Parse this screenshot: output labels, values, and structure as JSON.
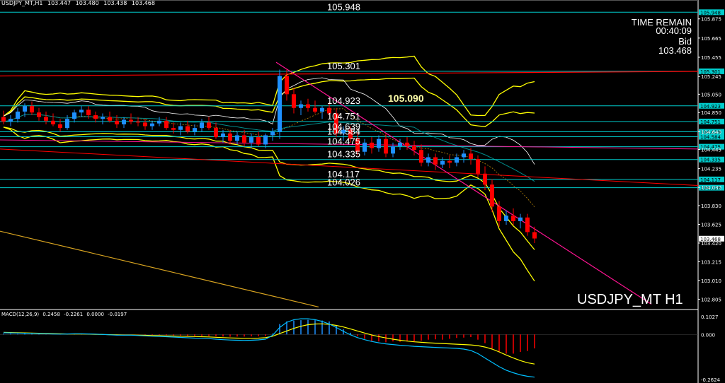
{
  "header": {
    "symbol_tf": "USDJPY_MT,H1",
    "open": "103.447",
    "high": "103.480",
    "low": "103.438",
    "close": "103.468"
  },
  "info_panel": {
    "time_remain_label": "TIME REMAIN",
    "time_remain_value": "00:40:09",
    "bid_label": "Bid",
    "bid_value": "103.468"
  },
  "watermark": "USDJPY_MT H1",
  "macd_header": {
    "name": "MACD(12,26,9)",
    "v1": "0.2458",
    "v2": "-0.2261",
    "v3": "0.0000",
    "v4": "-0.0197"
  },
  "colors": {
    "background": "#000000",
    "bull_candle": "#1e90ff",
    "bear_candle": "#ff0000",
    "bollinger": "#ffff00",
    "level_line": "#00cccc",
    "trend_line": "#ff1493",
    "red_line": "#ff0000",
    "macd_signal": "#ffff00",
    "macd_line": "#00bfff"
  },
  "chart_data": {
    "type": "candlestick",
    "symbol": "USDJPY_MT",
    "timeframe": "H1",
    "ylim": [
      102.7,
      106.02
    ],
    "price_axis_ticks": [
      "105.875",
      "105.665",
      "105.455",
      "105.245",
      "105.050",
      "104.850",
      "104.640",
      "104.445",
      "104.235",
      "104.030",
      "103.830",
      "103.625",
      "103.420",
      "103.215",
      "103.010",
      "102.805"
    ],
    "level_lines": [
      {
        "price": 105.948,
        "label": "105.948"
      },
      {
        "price": 105.301,
        "label": "105.301"
      },
      {
        "price": 104.923,
        "label": "104.923"
      },
      {
        "price": 104.751,
        "label": "104.751"
      },
      {
        "price": 104.639,
        "label": "104.639"
      },
      {
        "price": 104.584,
        "label": "104.584"
      },
      {
        "price": 104.475,
        "label": "104.475"
      },
      {
        "price": 104.335,
        "label": "104.335"
      },
      {
        "price": 104.117,
        "label": "104.117"
      },
      {
        "price": 104.026,
        "label": "104.026"
      }
    ],
    "highlight_label": "105.090",
    "current_price": "103.468",
    "candles": [
      [
        104.8,
        104.87,
        104.72,
        104.75
      ],
      [
        104.75,
        104.82,
        104.7,
        104.78
      ],
      [
        104.78,
        104.9,
        104.74,
        104.86
      ],
      [
        104.86,
        104.95,
        104.8,
        104.92
      ],
      [
        104.92,
        104.97,
        104.82,
        104.85
      ],
      [
        104.85,
        104.9,
        104.76,
        104.8
      ],
      [
        104.8,
        104.86,
        104.72,
        104.76
      ],
      [
        104.76,
        104.84,
        104.7,
        104.72
      ],
      [
        104.72,
        104.78,
        104.64,
        104.68
      ],
      [
        104.68,
        104.82,
        104.66,
        104.78
      ],
      [
        104.78,
        104.88,
        104.74,
        104.85
      ],
      [
        104.85,
        104.92,
        104.8,
        104.88
      ],
      [
        104.88,
        104.92,
        104.78,
        104.82
      ],
      [
        104.82,
        104.86,
        104.74,
        104.78
      ],
      [
        104.78,
        104.84,
        104.72,
        104.8
      ],
      [
        104.8,
        104.86,
        104.74,
        104.76
      ],
      [
        104.76,
        104.82,
        104.68,
        104.72
      ],
      [
        104.72,
        104.8,
        104.68,
        104.77
      ],
      [
        104.77,
        104.84,
        104.72,
        104.75
      ],
      [
        104.75,
        104.8,
        104.7,
        104.74
      ],
      [
        104.74,
        104.78,
        104.66,
        104.7
      ],
      [
        104.7,
        104.76,
        104.66,
        104.73
      ],
      [
        104.73,
        104.8,
        104.7,
        104.76
      ],
      [
        104.76,
        104.8,
        104.66,
        104.68
      ],
      [
        104.68,
        104.74,
        104.62,
        104.66
      ],
      [
        104.66,
        104.74,
        104.6,
        104.7
      ],
      [
        104.7,
        104.76,
        104.62,
        104.64
      ],
      [
        104.64,
        104.72,
        104.6,
        104.68
      ],
      [
        104.68,
        104.78,
        104.64,
        104.74
      ],
      [
        104.74,
        104.8,
        104.66,
        104.68
      ],
      [
        104.68,
        104.74,
        104.56,
        104.58
      ],
      [
        104.58,
        104.66,
        104.52,
        104.62
      ],
      [
        104.62,
        104.66,
        104.5,
        104.54
      ],
      [
        104.54,
        104.64,
        104.5,
        104.6
      ],
      [
        104.6,
        104.66,
        104.48,
        104.52
      ],
      [
        104.52,
        104.62,
        104.46,
        104.58
      ],
      [
        104.58,
        104.64,
        104.48,
        104.5
      ],
      [
        104.5,
        104.62,
        104.46,
        104.6
      ],
      [
        104.6,
        104.68,
        104.54,
        104.64
      ],
      [
        104.64,
        105.32,
        104.56,
        105.25
      ],
      [
        105.25,
        105.32,
        104.98,
        105.05
      ],
      [
        105.05,
        105.12,
        104.84,
        104.9
      ],
      [
        104.9,
        104.98,
        104.82,
        104.94
      ],
      [
        104.94,
        105.0,
        104.86,
        104.9
      ],
      [
        104.9,
        104.98,
        104.84,
        104.86
      ],
      [
        104.86,
        104.92,
        104.78,
        104.9
      ],
      [
        104.9,
        104.96,
        104.82,
        104.84
      ],
      [
        104.84,
        104.9,
        104.58,
        104.62
      ],
      [
        104.62,
        104.7,
        104.54,
        104.66
      ],
      [
        104.66,
        104.7,
        104.52,
        104.56
      ],
      [
        104.56,
        104.64,
        104.38,
        104.42
      ],
      [
        104.42,
        104.56,
        104.38,
        104.52
      ],
      [
        104.52,
        104.58,
        104.4,
        104.46
      ],
      [
        104.46,
        104.6,
        104.42,
        104.56
      ],
      [
        104.56,
        104.62,
        104.36,
        104.4
      ],
      [
        104.4,
        104.52,
        104.36,
        104.48
      ],
      [
        104.48,
        104.56,
        104.44,
        104.52
      ],
      [
        104.52,
        104.58,
        104.44,
        104.48
      ],
      [
        104.48,
        104.54,
        104.38,
        104.44
      ],
      [
        104.44,
        104.5,
        104.26,
        104.3
      ],
      [
        104.3,
        104.4,
        104.26,
        104.36
      ],
      [
        104.36,
        104.4,
        104.22,
        104.28
      ],
      [
        104.28,
        104.36,
        104.24,
        104.32
      ],
      [
        104.32,
        104.38,
        104.24,
        104.3
      ],
      [
        104.3,
        104.4,
        104.26,
        104.36
      ],
      [
        104.36,
        104.44,
        104.3,
        104.4
      ],
      [
        104.4,
        104.46,
        104.28,
        104.34
      ],
      [
        104.34,
        104.38,
        104.14,
        104.18
      ],
      [
        104.18,
        104.26,
        104.0,
        104.06
      ],
      [
        104.06,
        104.12,
        103.76,
        103.82
      ],
      [
        103.82,
        103.88,
        103.6,
        103.66
      ],
      [
        103.66,
        103.78,
        103.62,
        103.72
      ],
      [
        103.72,
        103.8,
        103.62,
        103.66
      ],
      [
        103.66,
        103.74,
        103.58,
        103.7
      ],
      [
        103.7,
        103.74,
        103.5,
        103.54
      ],
      [
        103.54,
        103.6,
        103.42,
        103.47
      ]
    ],
    "macd": {
      "ylim": [
        -0.2624,
        0.1027
      ],
      "ticks": [
        "0.1027",
        "0.000",
        "-0.2624"
      ],
      "histogram": [
        0.005,
        0.004,
        0.003,
        0.004,
        0.003,
        0.002,
        0.001,
        0.0,
        -0.001,
        0.001,
        0.002,
        0.003,
        0.002,
        0.001,
        0.0,
        -0.001,
        -0.002,
        -0.001,
        0.0,
        -0.001,
        -0.002,
        -0.003,
        -0.003,
        -0.004,
        -0.005,
        -0.006,
        -0.007,
        -0.008,
        -0.008,
        -0.009,
        -0.01,
        -0.012,
        -0.013,
        -0.012,
        -0.012,
        -0.011,
        -0.01,
        -0.009,
        0.005,
        0.06,
        0.075,
        0.08,
        0.082,
        0.084,
        0.082,
        0.08,
        0.075,
        0.05,
        0.03,
        0.01,
        -0.01,
        -0.025,
        -0.04,
        -0.04,
        -0.045,
        -0.04,
        -0.042,
        -0.038,
        -0.04,
        -0.035,
        -0.03,
        -0.028,
        -0.03,
        -0.025,
        -0.02,
        -0.018,
        -0.015,
        -0.03,
        -0.05,
        -0.08,
        -0.1,
        -0.11,
        -0.11,
        -0.1,
        -0.095,
        -0.08
      ],
      "signal": [
        0.012,
        0.011,
        0.01,
        0.009,
        0.008,
        0.007,
        0.006,
        0.005,
        0.004,
        0.003,
        0.003,
        0.003,
        0.002,
        0.001,
        0.0,
        -0.001,
        -0.002,
        -0.003,
        -0.003,
        -0.004,
        -0.005,
        -0.006,
        -0.007,
        -0.008,
        -0.009,
        -0.01,
        -0.011,
        -0.012,
        -0.013,
        -0.014,
        -0.016,
        -0.018,
        -0.02,
        -0.021,
        -0.022,
        -0.022,
        -0.021,
        -0.018,
        -0.01,
        0.005,
        0.02,
        0.035,
        0.047,
        0.056,
        0.06,
        0.061,
        0.058,
        0.052,
        0.043,
        0.032,
        0.02,
        0.008,
        -0.003,
        -0.012,
        -0.02,
        -0.027,
        -0.033,
        -0.038,
        -0.042,
        -0.045,
        -0.048,
        -0.05,
        -0.052,
        -0.054,
        -0.056,
        -0.058,
        -0.06,
        -0.064,
        -0.072,
        -0.084,
        -0.1,
        -0.118,
        -0.135,
        -0.15,
        -0.162,
        -0.17
      ],
      "macd_line": [
        0.01,
        0.009,
        0.008,
        0.007,
        0.006,
        0.005,
        0.004,
        0.003,
        0.002,
        0.003,
        0.004,
        0.004,
        0.003,
        0.002,
        0.0,
        -0.002,
        -0.004,
        -0.004,
        -0.004,
        -0.006,
        -0.008,
        -0.01,
        -0.011,
        -0.013,
        -0.015,
        -0.017,
        -0.019,
        -0.021,
        -0.022,
        -0.024,
        -0.027,
        -0.03,
        -0.032,
        -0.033,
        -0.034,
        -0.033,
        -0.031,
        -0.027,
        -0.005,
        0.04,
        0.07,
        0.085,
        0.09,
        0.09,
        0.085,
        0.075,
        0.06,
        0.04,
        0.018,
        -0.002,
        -0.018,
        -0.03,
        -0.04,
        -0.048,
        -0.054,
        -0.058,
        -0.062,
        -0.065,
        -0.068,
        -0.07,
        -0.072,
        -0.074,
        -0.076,
        -0.078,
        -0.08,
        -0.084,
        -0.092,
        -0.11,
        -0.135,
        -0.16,
        -0.185,
        -0.205,
        -0.22,
        -0.232,
        -0.24,
        -0.245
      ]
    }
  }
}
